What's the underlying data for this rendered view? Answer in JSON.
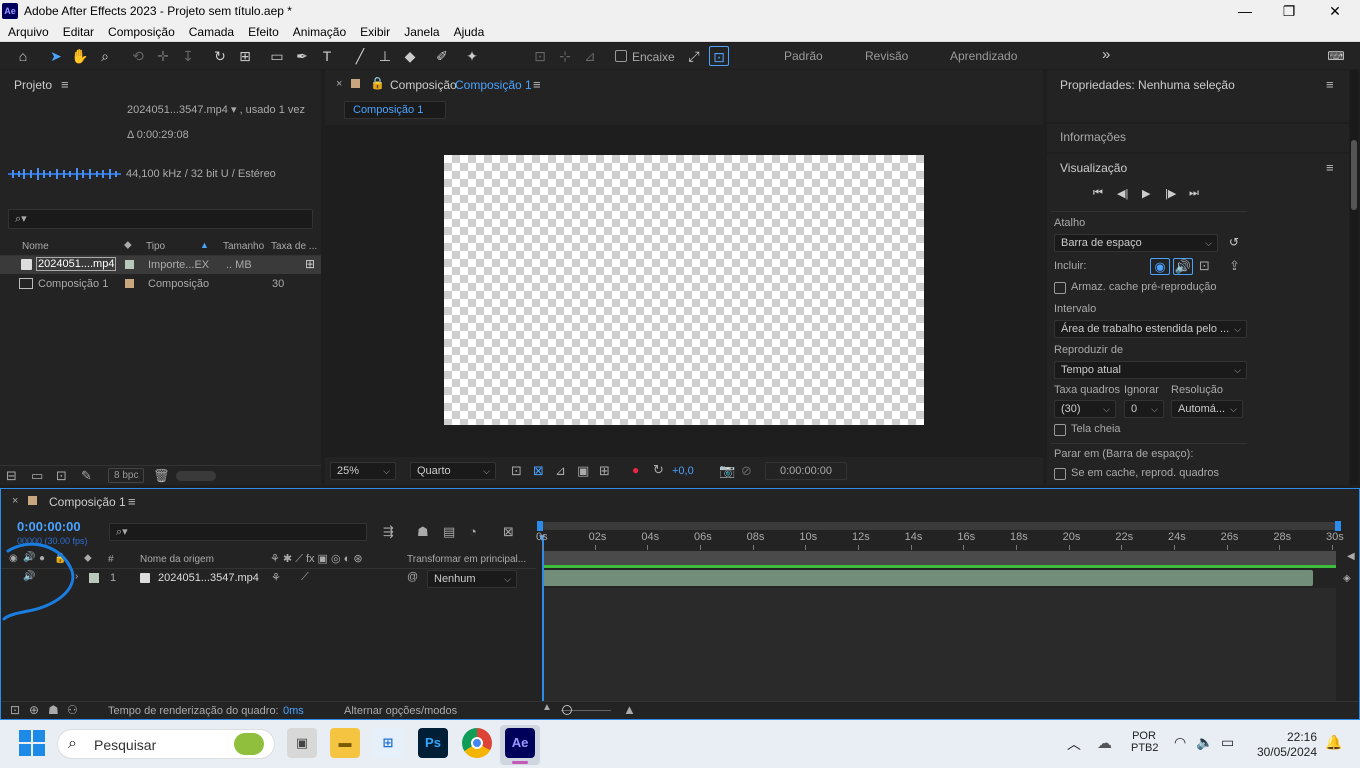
{
  "window": {
    "logo": "Ae",
    "title": "Adobe After Effects 2023 - Projeto sem título.aep *",
    "minimize": "—",
    "maximize": "❐",
    "close": "✕"
  },
  "menu": [
    "Arquivo",
    "Editar",
    "Composição",
    "Camada",
    "Efeito",
    "Animação",
    "Exibir",
    "Janela",
    "Ajuda"
  ],
  "toolbar": {
    "snap_label": "Encaixe",
    "workspaces": [
      "Padrão",
      "Revisão",
      "Aprendizado"
    ],
    "more": "»"
  },
  "project": {
    "title": "Projeto",
    "file_name": "2024051...3547.mp4",
    "used": ", usado 1 vez",
    "duration": "Δ 0:00:29:08",
    "audio_info": "44,100 kHz / 32 bit U / Estéreo",
    "columns": [
      "Nome",
      "Tipo",
      "Tamanho",
      "Taxa de ..."
    ],
    "rows": [
      {
        "name": "2024051....mp4",
        "type": "Importe...EX",
        "size": ".. MB",
        "rate": "",
        "color": "#b9c9b9"
      },
      {
        "name": "Composição 1",
        "type": "Composição",
        "size": "",
        "rate": "30",
        "color": "#c8a77e"
      }
    ],
    "bpc": "8 bpc"
  },
  "composition": {
    "panel_label": "Composição",
    "comp_name": "Composição 1",
    "tab": "Composição 1",
    "zoom": "25%",
    "resolution": "Quarto",
    "exposure": "+0,0",
    "timecode": "0:00:00:00"
  },
  "properties": {
    "title": "Propriedades: Nenhuma seleção",
    "info": "Informações",
    "preview_title": "Visualização",
    "shortcut_label": "Atalho",
    "shortcut_value": "Barra de espaço",
    "include_label": "Incluir:",
    "cache_label": "Armaz. cache pré-reprodução",
    "interval_label": "Intervalo",
    "interval_value": "Área de trabalho estendida pelo ...",
    "play_from_label": "Reproduzir de",
    "play_from_value": "Tempo atual",
    "fps_label": "Taxa quadros",
    "skip_label": "Ignorar",
    "res_label": "Resolução",
    "fps_value": "(30)",
    "skip_value": "0",
    "res_value": "Automá...",
    "fullscreen_label": "Tela cheia",
    "stop_label": "Parar em (Barra de espaço):",
    "cache_play_label": "Se em cache, reprod. quadros"
  },
  "timeline": {
    "tab": "Composição 1",
    "timecode": "0:00:00:00",
    "fps": "00000 (30.00 fps)",
    "col_hash": "#",
    "col_source": "Nome da origem",
    "col_parent": "Transformar em principal...",
    "layer_num": "1",
    "layer_name": "2024051...3547.mp4",
    "parent_value": "Nenhum",
    "ticks": [
      "0s",
      "02s",
      "04s",
      "06s",
      "08s",
      "10s",
      "12s",
      "14s",
      "16s",
      "18s",
      "20s",
      "22s",
      "24s",
      "26s",
      "28s",
      "30s"
    ],
    "render_label": "Tempo de renderização do quadro:",
    "render_value": "0ms",
    "toggle_label": "Alternar opções/modos"
  },
  "taskbar": {
    "search": "Pesquisar",
    "lang1": "POR",
    "lang2": "PTB2",
    "time": "22:16",
    "date": "30/05/2024",
    "ps": "Ps",
    "ae": "Ae"
  },
  "colors": {
    "accent": "#4aa3ff",
    "annotation": "#1a7de0"
  }
}
